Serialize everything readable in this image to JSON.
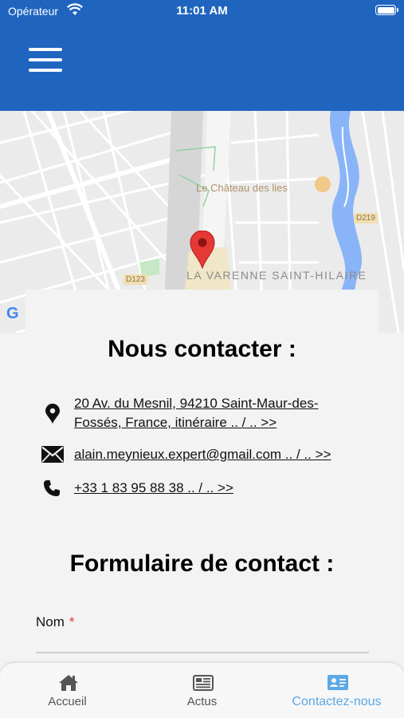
{
  "status_bar": {
    "carrier": "Opérateur",
    "time": "11:01 AM"
  },
  "map": {
    "poi_label": "Le Château des lies",
    "district_label": "LA VARENNE SAINT-HILAIRE",
    "road_labels": [
      "D123",
      "D219"
    ],
    "attribution": "G"
  },
  "contact": {
    "title": "Nous contacter :",
    "address_line1": "20 Av. du Mesnil, 94210 Saint-Maur-des-",
    "address_line2": "Fossés, France, itinéraire .. / .. >>",
    "email": "alain.meynieux.expert@gmail.com .. / .. >>",
    "phone": "+33 1 83 95 88 38  .. / .. >>"
  },
  "form": {
    "title": "Formulaire de contact :",
    "name_label": "Nom",
    "required_mark": "*"
  },
  "nav": {
    "items": [
      {
        "label": "Accueil",
        "icon": "home-icon"
      },
      {
        "label": "Actus",
        "icon": "newspaper-icon"
      },
      {
        "label": "Contactez-nous",
        "icon": "contact-card-icon",
        "active": true
      }
    ]
  },
  "colors": {
    "header": "#1f65bf",
    "active_nav": "#5aa8e6",
    "pin": "#e53935",
    "required": "#e53935"
  }
}
